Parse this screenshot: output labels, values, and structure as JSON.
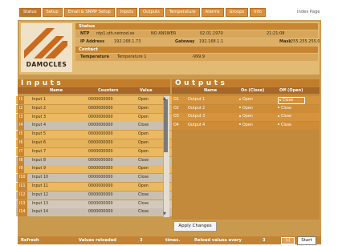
{
  "nav": {
    "tabs": [
      "Status",
      "Setup",
      "Email & SNMP Setup",
      "Inputs",
      "Outputs",
      "Temperature",
      "Alarms",
      "Groups",
      "Info"
    ],
    "index_page": "Index Page"
  },
  "logo_text": "DAMOCLES",
  "status": {
    "title": "Status",
    "ntp_label": "NTP",
    "ntp_server": "ntp1.sth.netnod.se",
    "ntp_state": "NO ANSWER",
    "date": "02.01.1970",
    "time": "21:21:08",
    "ip_label": "IP Address",
    "ip": "192.168.1.73",
    "gateway_label": "Gateway",
    "gateway": "192.168.1.1",
    "mask_label": "Mask",
    "mask": "255.255.255.0",
    "contact_label": "Contact",
    "temp_label": "Temperature",
    "temp_name": "Temperature 1",
    "temp_value": "-999.9"
  },
  "inputs": {
    "title": "Inputs",
    "headers": {
      "name": "Name",
      "counters": "Counters",
      "value": "Value"
    },
    "rows": [
      {
        "id": "I1",
        "name": "Input 1",
        "counter": "0000000000",
        "value": "Open"
      },
      {
        "id": "I2",
        "name": "Input 2",
        "counter": "0000000000",
        "value": "Open"
      },
      {
        "id": "I3",
        "name": "Input 3",
        "counter": "0000000000",
        "value": "Open"
      },
      {
        "id": "I4",
        "name": "Input 4",
        "counter": "0000000000",
        "value": "Close"
      },
      {
        "id": "I5",
        "name": "Input 5",
        "counter": "0000000000",
        "value": "Open"
      },
      {
        "id": "I6",
        "name": "Input 6",
        "counter": "0000000000",
        "value": "Open"
      },
      {
        "id": "I7",
        "name": "Input 7",
        "counter": "0000000000",
        "value": "Open"
      },
      {
        "id": "I8",
        "name": "Input 8",
        "counter": "0000000000",
        "value": "Close"
      },
      {
        "id": "I9",
        "name": "Input 9",
        "counter": "0000000000",
        "value": "Open"
      },
      {
        "id": "I10",
        "name": "Input 10",
        "counter": "0000000000",
        "value": "Close"
      },
      {
        "id": "I11",
        "name": "Input 11",
        "counter": "0000000000",
        "value": "Open"
      },
      {
        "id": "I12",
        "name": "Input 12",
        "counter": "0000000000",
        "value": "Close"
      },
      {
        "id": "I13",
        "name": "Input 13",
        "counter": "0000000000",
        "value": "Close"
      },
      {
        "id": "I14",
        "name": "Input 14",
        "counter": "0000000000",
        "value": "Close"
      }
    ]
  },
  "outputs": {
    "title": "Outputs",
    "headers": {
      "name": "Name",
      "on": "On (Close)",
      "off": "Off (Open)"
    },
    "rows": [
      {
        "id": "O1",
        "name": "Output 1",
        "on": "Open",
        "off": "Close"
      },
      {
        "id": "O2",
        "name": "Output 2",
        "on": "Open",
        "off": "Close"
      },
      {
        "id": "O3",
        "name": "Output 3",
        "on": "Open",
        "off": "Close"
      },
      {
        "id": "O4",
        "name": "Output 4",
        "on": "Open",
        "off": "Close"
      }
    ]
  },
  "apply_label": "Apply Changes",
  "footer": {
    "refresh": "Refresh",
    "values_reloaded": "Values reloaded",
    "count": "3",
    "times": "times.",
    "reload_every": "Reload values every",
    "interval": "3",
    "unit": "[s]",
    "start": "Start"
  },
  "colors": {
    "accent": "#c27d2c",
    "frame": "#c99a4e"
  }
}
